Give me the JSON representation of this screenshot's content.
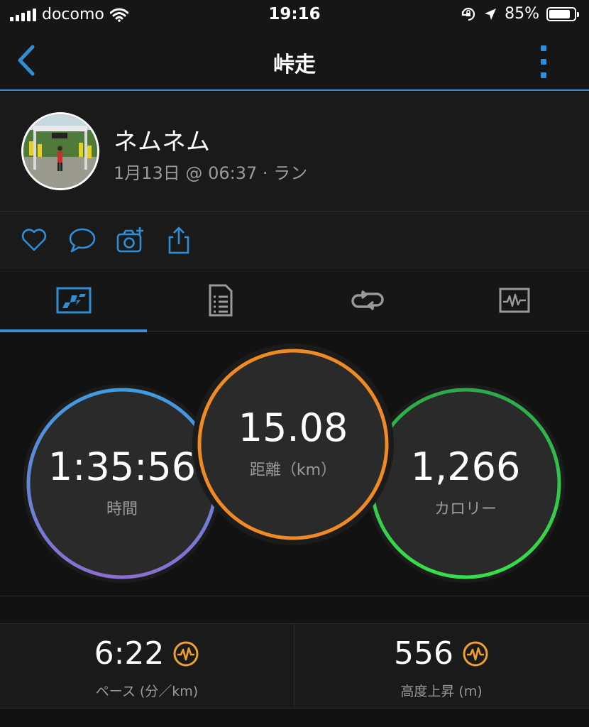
{
  "status_bar": {
    "carrier": "docomo",
    "time": "19:16",
    "battery": "85%",
    "battery_level": 0.85
  },
  "nav": {
    "title": "峠走",
    "back_icon": "chevron-left-icon",
    "more_icon": "more-vertical-icon"
  },
  "profile": {
    "name": "ネムネム",
    "meta": "1月13日 @ 06:37 · ラン"
  },
  "actions": [
    "heart-icon",
    "comment-icon",
    "add-photo-icon",
    "share-icon"
  ],
  "tabs": {
    "selected_index": 0,
    "items": [
      "overview-icon",
      "details-icon",
      "laps-icon",
      "charts-icon"
    ]
  },
  "circles": {
    "time": {
      "value": "1:35:56",
      "label": "時間"
    },
    "distance": {
      "value": "15.08",
      "label": "距離（km）"
    },
    "calories": {
      "value": "1,266",
      "label": "カロリー"
    }
  },
  "stats": {
    "pace": {
      "value": "6:22",
      "label": "ペース (分／km)",
      "icon": "heart-rate-badge-icon"
    },
    "elevation": {
      "value": "556",
      "label": "高度上昇 (m)",
      "icon": "heart-rate-badge-icon"
    }
  },
  "colors": {
    "accent_blue": "#3f8fd0",
    "distance_ring": "#f08a24",
    "time_ring_top": "#3f9be0",
    "time_ring_bottom": "#8a6fd0",
    "calories_ring": "#2ecc4f",
    "badge_orange": "#f0a030"
  }
}
